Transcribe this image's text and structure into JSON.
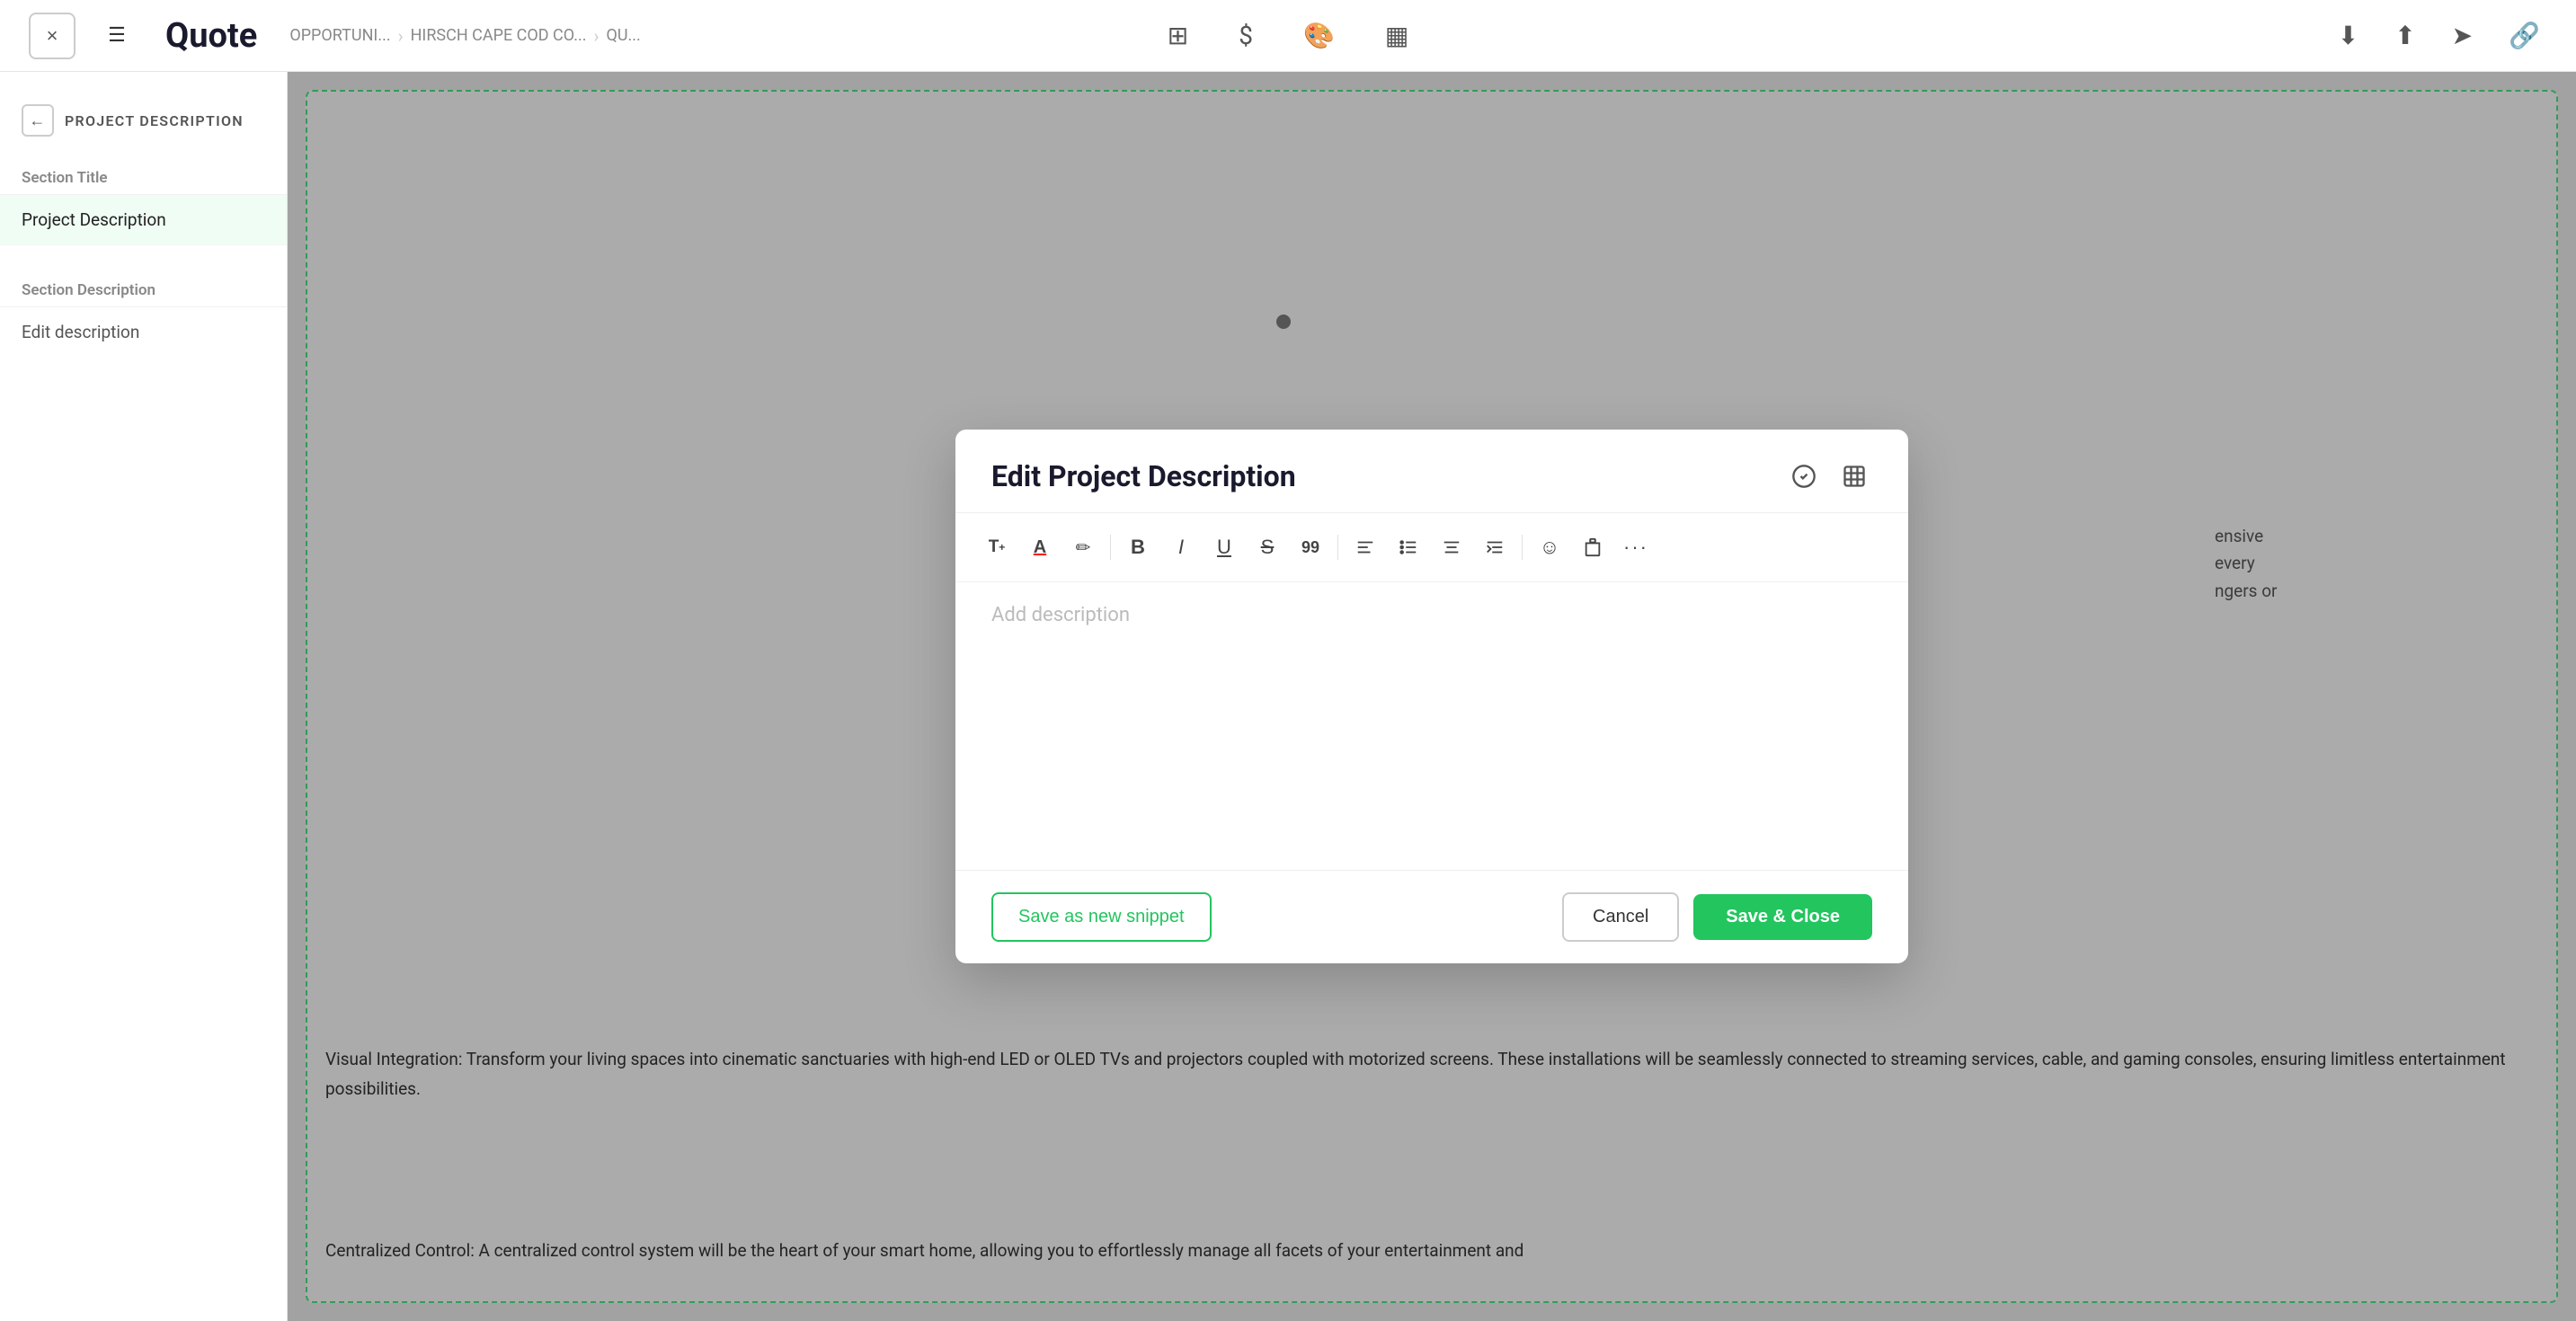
{
  "header": {
    "close_label": "×",
    "menu_label": "☰",
    "title": "Quote",
    "breadcrumb": [
      {
        "label": "OPPORTUNI..."
      },
      {
        "label": "HIRSCH CAPE COD CO..."
      },
      {
        "label": "QU..."
      }
    ],
    "icons": [
      "grid-icon",
      "dollar-icon",
      "palette-icon",
      "layout-icon"
    ],
    "right_icons": [
      "download-icon",
      "upload-icon",
      "send-icon",
      "link-icon"
    ]
  },
  "sidebar": {
    "back_label": "PROJECT DESCRIPTION",
    "section_title_header": "Section Title",
    "section_title_item": "Project Description",
    "section_desc_header": "Section Description",
    "section_desc_item": "Edit description"
  },
  "content": {
    "paragraphs": [
      "Visual Integration: Transform your living spaces into cinematic sanctuaries with high-end LED or OLED TVs and projectors coupled with motorized screens. These installations will be seamlessly connected to streaming services, cable, and gaming consoles, ensuring limitless entertainment possibilities.",
      "Centralized Control: A centralized control system will be the heart of your smart home, allowing you to effortlessly manage all facets of your entertainment and"
    ]
  },
  "modal": {
    "title": "Edit Project Description",
    "header_icons": [
      "check-circle-icon",
      "table-icon"
    ],
    "toolbar": [
      {
        "name": "text-style-icon",
        "symbol": "T₊"
      },
      {
        "name": "text-color-icon",
        "symbol": "A"
      },
      {
        "name": "highlight-icon",
        "symbol": "✏"
      },
      {
        "name": "bold-icon",
        "symbol": "B"
      },
      {
        "name": "italic-icon",
        "symbol": "I"
      },
      {
        "name": "underline-icon",
        "symbol": "U"
      },
      {
        "name": "strikethrough-icon",
        "symbol": "S"
      },
      {
        "name": "quote-icon",
        "symbol": "99"
      },
      {
        "name": "align-left-icon",
        "symbol": "≡"
      },
      {
        "name": "bullet-list-icon",
        "symbol": "☰"
      },
      {
        "name": "align-center-icon",
        "symbol": "≡"
      },
      {
        "name": "indent-icon",
        "symbol": "⇥"
      },
      {
        "name": "emoji-icon",
        "symbol": "☺"
      },
      {
        "name": "clipboard-icon",
        "symbol": "📋"
      },
      {
        "name": "more-icon",
        "symbol": "···"
      }
    ],
    "editor_placeholder": "Add description",
    "footer": {
      "snippet_btn": "Save as new snippet",
      "cancel_btn": "Cancel",
      "save_btn": "Save & Close"
    }
  },
  "colors": {
    "accent_green": "#22c55e",
    "dashed_border": "#4ade80",
    "title_dark": "#1a1a2e"
  }
}
